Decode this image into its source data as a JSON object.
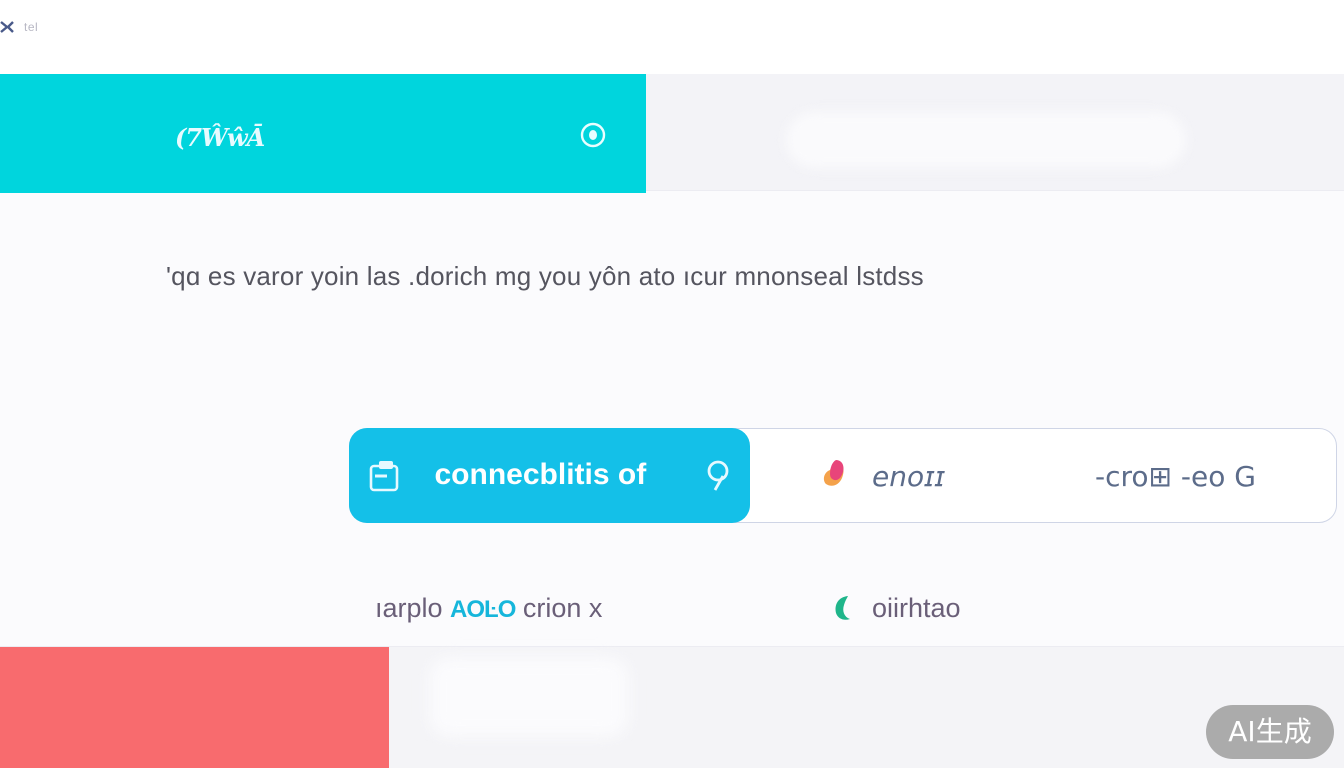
{
  "app": {
    "logo_text": "tel"
  },
  "hero": {
    "title": "(7ŴŵĀ",
    "target_icon": "target-icon"
  },
  "description": "'qɑ es varor yoin las .dorich mg you yôn ato ıcur mnonseal lstdss",
  "tabs": [
    {
      "label": "connecblitis of",
      "icon": "clipboard-icon",
      "active": true,
      "trailing_icon": "help-icon"
    },
    {
      "label": "enoɪɪ",
      "icon": "heart-icon",
      "active": false
    },
    {
      "label": "-cro⊞ -eo G",
      "active": false
    }
  ],
  "legend": {
    "item1_prefix": "ıarplo ",
    "item1_accent": "AOĿO",
    "item1_suffix": " crion x",
    "item2_label": "oiirhtao",
    "item2_icon": "leaf-icon"
  },
  "badge": {
    "label": "AI生成"
  },
  "colors": {
    "hero": "#00d5dd",
    "active_tab": "#14c0e8",
    "coral": "#f86b6e",
    "leaf": "#1fb58a"
  }
}
